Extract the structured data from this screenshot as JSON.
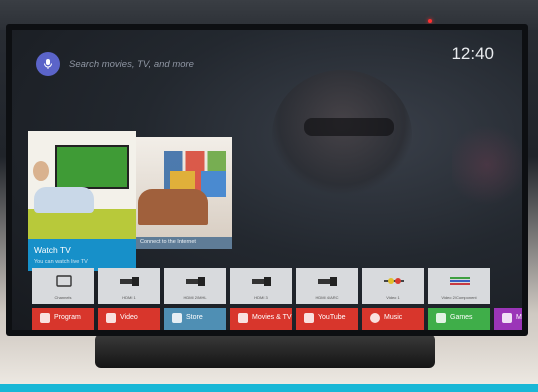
{
  "search": {
    "placeholder": "Search movies, TV, and more"
  },
  "clock": {
    "time": "12:40"
  },
  "featured": [
    {
      "title": "Watch TV",
      "subtitle": "You can watch live TV"
    },
    {
      "title": "Connect to the Internet"
    }
  ],
  "inputs": [
    {
      "label": "Channels",
      "icon": "channels-icon"
    },
    {
      "label": "HDMI 1",
      "icon": "hdmi-icon"
    },
    {
      "label": "HDMI 2/MHL",
      "icon": "hdmi-icon"
    },
    {
      "label": "HDMI 3",
      "icon": "hdmi-icon"
    },
    {
      "label": "HDMI 4/ARC",
      "icon": "hdmi-icon"
    },
    {
      "label": "Video 1",
      "icon": "composite-icon"
    },
    {
      "label": "Video 2/Component",
      "icon": "component-icon"
    }
  ],
  "apps": [
    {
      "label": "Program",
      "color": "#d8362c"
    },
    {
      "label": "Video",
      "color": "#d8362c"
    },
    {
      "label": "Store",
      "color": "#4f8fb4"
    },
    {
      "label": "Movies & TV",
      "color": "#d8362c"
    },
    {
      "label": "YouTube",
      "color": "#d8362c"
    },
    {
      "label": "Music",
      "color": "#d8362c"
    },
    {
      "label": "Games",
      "color": "#3fae49"
    },
    {
      "label": "Mu",
      "color": "#9b35b8"
    }
  ],
  "colors": {
    "accent": "#1790c9",
    "mic": "#5b64c9"
  }
}
